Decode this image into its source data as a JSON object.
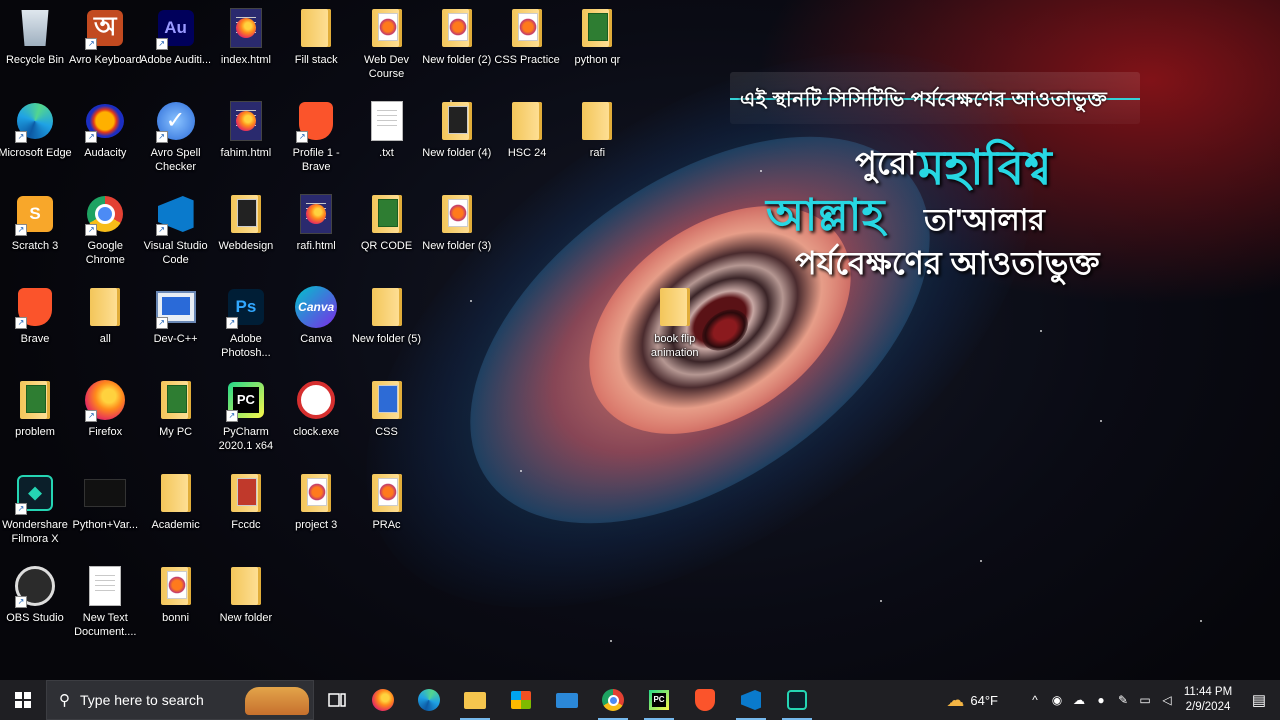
{
  "desktop": {
    "icons": [
      {
        "label": "Recycle Bin",
        "kind": "recycle"
      },
      {
        "label": "Avro Keyboard",
        "kind": "avro"
      },
      {
        "label": "Adobe Auditi...",
        "kind": "au"
      },
      {
        "label": "index.html",
        "kind": "firefox-doc"
      },
      {
        "label": "Fill stack",
        "kind": "folder"
      },
      {
        "label": "Web Dev Course",
        "kind": "folder-fx"
      },
      {
        "label": "New folder (2)",
        "kind": "folder-fx"
      },
      {
        "label": "CSS Practice",
        "kind": "folder-fx"
      },
      {
        "label": "python qr",
        "kind": "folder-green"
      },
      {
        "label": "Microsoft Edge",
        "kind": "edge"
      },
      {
        "label": "Audacity",
        "kind": "audacity"
      },
      {
        "label": "Avro Spell Checker",
        "kind": "check"
      },
      {
        "label": "fahim.html",
        "kind": "firefox-doc"
      },
      {
        "label": "Profile 1 - Brave",
        "kind": "brave"
      },
      {
        "label": ".txt",
        "kind": "doc"
      },
      {
        "label": "New folder (4)",
        "kind": "folder-dark"
      },
      {
        "label": "HSC 24",
        "kind": "folder"
      },
      {
        "label": "rafi",
        "kind": "folder"
      },
      {
        "label": "Scratch 3",
        "kind": "scratch"
      },
      {
        "label": "Google Chrome",
        "kind": "chrome"
      },
      {
        "label": "Visual Studio Code",
        "kind": "vscode"
      },
      {
        "label": "Webdesign",
        "kind": "folder-dark"
      },
      {
        "label": "rafi.html",
        "kind": "firefox-doc"
      },
      {
        "label": "QR CODE",
        "kind": "folder-green"
      },
      {
        "label": "New folder (3)",
        "kind": "folder-fx"
      },
      {
        "label": "Brave",
        "kind": "brave"
      },
      {
        "label": "all",
        "kind": "folder"
      },
      {
        "label": "Dev-C++",
        "kind": "devcpp"
      },
      {
        "label": "Adobe Photosh...",
        "kind": "ps"
      },
      {
        "label": "Canva",
        "kind": "canva"
      },
      {
        "label": "New folder (5)",
        "kind": "folder"
      },
      {
        "label": "book flip animation",
        "kind": "folder"
      },
      {
        "label": "problem",
        "kind": "folder-green"
      },
      {
        "label": "Firefox",
        "kind": "firefox"
      },
      {
        "label": "My PC",
        "kind": "folder-green"
      },
      {
        "label": "PyCharm 2020.1 x64",
        "kind": "pycharm"
      },
      {
        "label": "clock.exe",
        "kind": "clock"
      },
      {
        "label": "CSS",
        "kind": "folder-blue"
      },
      {
        "label": "Wondershare Filmora X",
        "kind": "filmora"
      },
      {
        "label": "Python+Var...",
        "kind": "dark-thumb"
      },
      {
        "label": "Academic",
        "kind": "folder"
      },
      {
        "label": "Fccdc",
        "kind": "folder-avro"
      },
      {
        "label": "project 3",
        "kind": "folder-fx"
      },
      {
        "label": "PRAc",
        "kind": "folder-fx"
      },
      {
        "label": "OBS Studio",
        "kind": "obs"
      },
      {
        "label": "New Text Document....",
        "kind": "doc"
      },
      {
        "label": "bonni",
        "kind": "folder-fx"
      },
      {
        "label": "New folder",
        "kind": "folder"
      }
    ]
  },
  "overlay": {
    "banner": "এই স্থানটি সিসিটিভি পর্যবেক্ষণের আওতাভুক্ত",
    "line1_white": "পুরো",
    "line1_cyan": "মহাবিশ্ব",
    "line2_cyan": "আল্লাহ",
    "line2_white": "তা'আলার",
    "line3": "পর্যবেক্ষণের আওতাভুক্ত"
  },
  "taskbar": {
    "search_placeholder": "Type here to search",
    "apps": [
      "task-view",
      "firefox",
      "edge",
      "file-explorer",
      "store",
      "mail",
      "chrome",
      "pycharm",
      "brave",
      "vscode",
      "filmora"
    ],
    "weather": "64°F",
    "time": "11:44 PM",
    "date": "2/9/2024"
  },
  "colors": {
    "taskbar_bg": "#1f1f23",
    "accent": "#27d7e3",
    "banner_line": "#35d2d6"
  }
}
